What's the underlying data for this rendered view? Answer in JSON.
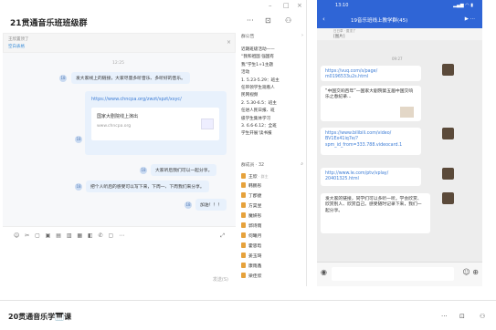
{
  "desktop": {
    "window_controls": [
      "–",
      "□",
      "×"
    ],
    "title": "21贯通音乐班班级群",
    "header_icons": [
      "···",
      "⊡",
      "⚇"
    ],
    "notice": {
      "line1": "王欣置顶了",
      "line2": "空白表格",
      "close": "×"
    },
    "chat": {
      "timestamp": "12:25",
      "msg1": "发大家线上的链接，大家尽量多听音乐、多听好的音乐。",
      "link": {
        "url": "https://www.chncpa.org/zwzt/spzt/xsyc/",
        "title": "国家大剧院线上演出",
        "domain": "www.chncpa.org"
      },
      "msg2": "大家听后我们可以一起分享。",
      "msg3": "把个人听后的感受可以写下来，下周一、下周我们来分享。",
      "msg4": "加油！！！",
      "avatar_text": "18"
    },
    "toolbar": {
      "icons": "☺ ✂ ▢ ▣ ▤ ▥ ▦ ◧ ✆ ▢ ⋯",
      "expand": "⤢",
      "send": "发送(S)"
    },
    "sidebar": {
      "announce_header": "群公告",
      "announce_chevron": "›",
      "announce_lines": [
        "近期班级活动——",
        "“我和祖国 强国有",
        "我”学生1+1主题",
        "活动",
        "1. 5.23-5.29：班主",
        "任带领学生观看人",
        "民网视频",
        "2. 5.30-6.5：班主",
        "任进人民日报、班",
        "级学生集体学习",
        "3. 6.6-6.12：全班",
        "学生开展‘读书报"
      ],
      "members_header": "群成员 · 32",
      "members_icon": "⌕",
      "members": [
        {
          "name": "王欣",
          "tag": "· 群主"
        },
        {
          "name": "韩鹏彤",
          "tag": ""
        },
        {
          "name": "丁郡捷",
          "tag": ""
        },
        {
          "name": "方昊昱",
          "tag": ""
        },
        {
          "name": "魔妍彤",
          "tag": ""
        },
        {
          "name": "郭诗雨",
          "tag": ""
        },
        {
          "name": "何曦月",
          "tag": ""
        },
        {
          "name": "霍思晗",
          "tag": ""
        },
        {
          "name": "姜玉琦",
          "tag": ""
        },
        {
          "name": "康雨鑫",
          "tag": ""
        },
        {
          "name": "梁佳欣",
          "tag": ""
        }
      ]
    }
  },
  "phone": {
    "status": {
      "time": "13:10",
      "icons": "▂▄▆ ◠ ▮"
    },
    "nav": {
      "back": "‹",
      "title": "19音乐班线上教学群(45)",
      "icons": "▶ ···"
    },
    "pinned": {
      "label": "[图片]",
      "sub": "日日草 · 置顶了"
    },
    "time": "09:27",
    "msgs": [
      {
        "text": "https://vuq.com/s/page/ m0196533u2s.html",
        "black": false
      },
      {
        "text": "“中国交响百年”—国家大剧院第五届中国交响乐之春纪录...",
        "black": true
      },
      {
        "text": "https://www.bilibili.com/video/ BV1Ex41iq7e/? spm_id_from=333.788.videocard.1",
        "black": false
      },
      {
        "text": "http://www.le.com/ptv/vplay/ 20401325.html",
        "black": false
      },
      {
        "text": "发大家的链接，同学们可以多听一听。学会欣赏、欣赏别人、欣赏自己。感受随时记录下来，我们一起分享。",
        "black": true
      }
    ],
    "input_icons": {
      "left": "◉",
      "right": "☺ ⊕"
    }
  },
  "bottom_window": {
    "title": "20贯通音乐学🎹课",
    "icons": [
      "···",
      "⊡",
      "⚇"
    ]
  }
}
